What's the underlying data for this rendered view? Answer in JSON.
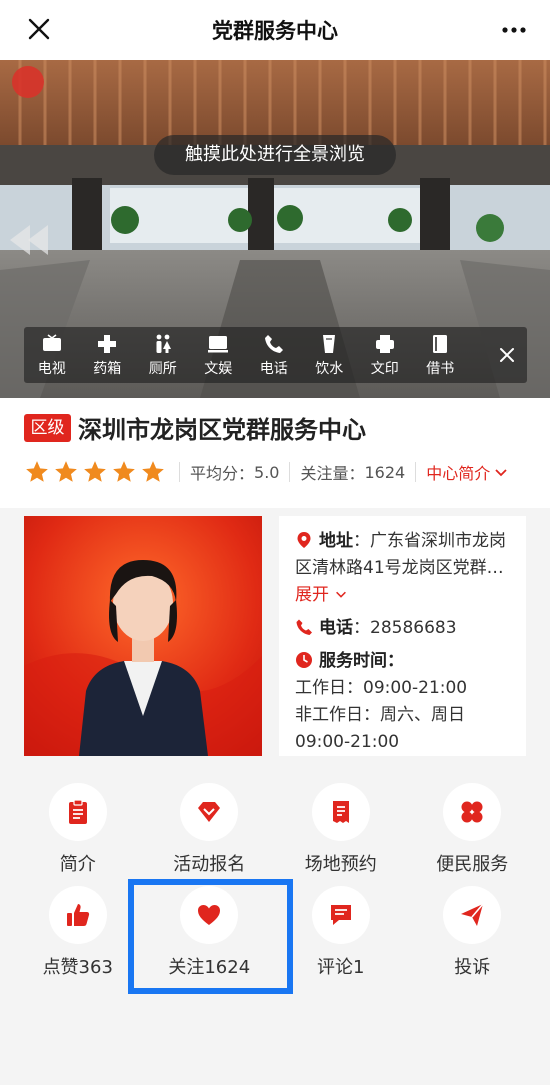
{
  "header": {
    "title": "党群服务中心",
    "close_icon": "close-icon",
    "more_icon": "more-icon"
  },
  "panorama": {
    "hint": "触摸此处进行全景浏览",
    "facilities": [
      {
        "label": "电视",
        "icon": "tv-icon"
      },
      {
        "label": "药箱",
        "icon": "medicine-icon"
      },
      {
        "label": "厕所",
        "icon": "restroom-icon"
      },
      {
        "label": "文娱",
        "icon": "entertainment-icon"
      },
      {
        "label": "电话",
        "icon": "phone-icon"
      },
      {
        "label": "饮水",
        "icon": "water-icon"
      },
      {
        "label": "文印",
        "icon": "print-icon"
      },
      {
        "label": "借书",
        "icon": "book-icon"
      }
    ]
  },
  "center": {
    "level": "区级",
    "name": "深圳市龙岗区党群服务中心",
    "avg_label": "平均分：",
    "avg_score": "5.0",
    "rating": 5,
    "follow_label": "关注量：",
    "follow_count": "1624",
    "intro_link": "中心简介"
  },
  "details": {
    "address_label": "地址",
    "address": "：广东省深圳市龙岗区清林路41号龙岗区党群…",
    "expand": "展开",
    "phone_label": "电话",
    "phone": "：28586683",
    "hours_label": "服务时间",
    "hours_colon": "：",
    "workday": "工作日：09:00-21:00",
    "weekend": "非工作日：周六、周日",
    "weekend_hours": "09:00-21:00"
  },
  "actions": [
    {
      "label": "简介",
      "icon": "clipboard-icon"
    },
    {
      "label": "活动报名",
      "icon": "diamond-icon"
    },
    {
      "label": "场地预约",
      "icon": "receipt-icon"
    },
    {
      "label": "便民服务",
      "icon": "grid-icon"
    },
    {
      "label": "点赞363",
      "icon": "thumbs-up-icon"
    },
    {
      "label": "关注1624",
      "icon": "heart-icon"
    },
    {
      "label": "评论1",
      "icon": "comment-icon"
    },
    {
      "label": "投诉",
      "icon": "send-icon"
    }
  ],
  "colors": {
    "accent": "#e0261e",
    "star": "#f08a1e",
    "highlight": "#1976f2"
  }
}
